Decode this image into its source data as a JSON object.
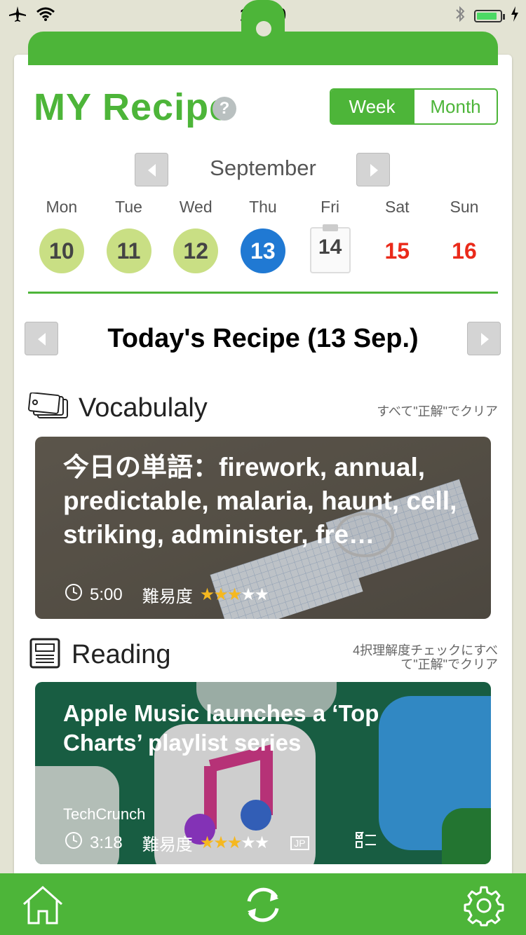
{
  "status": {
    "time": "18:50"
  },
  "header": {
    "title": "MY Recipe",
    "help": "?",
    "toggle": {
      "week": "Week",
      "month": "Month"
    }
  },
  "calendar": {
    "month": "September",
    "days": [
      {
        "name": "Mon",
        "num": "10",
        "state": "past"
      },
      {
        "name": "Tue",
        "num": "11",
        "state": "past"
      },
      {
        "name": "Wed",
        "num": "12",
        "state": "past"
      },
      {
        "name": "Thu",
        "num": "13",
        "state": "today"
      },
      {
        "name": "Fri",
        "num": "14",
        "state": "board"
      },
      {
        "name": "Sat",
        "num": "15",
        "state": "red"
      },
      {
        "name": "Sun",
        "num": "16",
        "state": "red"
      }
    ]
  },
  "today": {
    "title": "Today's Recipe (13 Sep.)"
  },
  "vocab": {
    "label": "Vocabulaly",
    "note": "すべて\"正解\"でクリア",
    "card_text": "今日の単語：firework, annual, predictable, malaria, haunt, cell, striking, administer, fre…",
    "time": "5:00",
    "difficulty_label": "難易度",
    "stars_filled": 3,
    "stars_total": 5
  },
  "reading": {
    "label": "Reading",
    "note_line1": "4択理解度チェックにすべ",
    "note_line2": "て\"正解\"でクリア",
    "card_title": "Apple Music launches a ‘Top Charts’ playlist series",
    "source": "TechCrunch",
    "time": "3:18",
    "difficulty_label": "難易度",
    "lang": "JP",
    "stars_filled": 3,
    "stars_total": 5
  },
  "colors": {
    "accent": "#4db539",
    "today": "#2079d3",
    "past": "#c9df84",
    "weekend": "#ea2a1a"
  }
}
